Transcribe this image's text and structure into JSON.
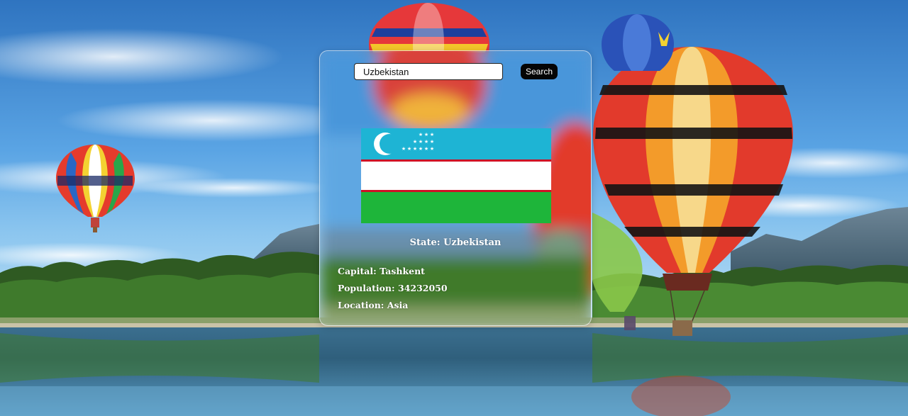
{
  "search": {
    "value": "Uzbekistan",
    "button_label": "Search"
  },
  "country": {
    "state_label": "State:",
    "state": "Uzbekistan",
    "capital_label": "Capital:",
    "capital": "Tashkent",
    "population_label": "Population:",
    "population": "34232050",
    "location_label": "Location:",
    "location": "Asia"
  },
  "flag": {
    "colors": {
      "top": "#1eb4d4",
      "stripe": "#ce1126",
      "middle": "#ffffff",
      "bottom": "#1eb53a"
    }
  }
}
